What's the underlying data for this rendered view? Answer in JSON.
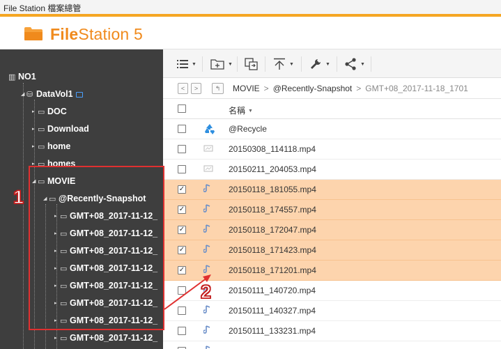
{
  "window": {
    "title": "File Station 檔案總管"
  },
  "app": {
    "logo_bold": "File",
    "logo_rest": "Station 5",
    "accent": "#f08a1c"
  },
  "tree": {
    "root": "NO1",
    "volume": "DataVol1",
    "folders": [
      "DOC",
      "Download",
      "home",
      "homes"
    ],
    "movie": "MOVIE",
    "snapshot": "@Recently-Snapshot",
    "snapshots": [
      "GMT+08_2017-11-12_",
      "GMT+08_2017-11-12_",
      "GMT+08_2017-11-12_",
      "GMT+08_2017-11-12_",
      "GMT+08_2017-11-12_",
      "GMT+08_2017-11-12_",
      "GMT+08_2017-11-12_",
      "GMT+08_2017-11-12_"
    ]
  },
  "toolbar": {
    "view": "list-view-icon",
    "new_folder": "new-folder-icon",
    "copy": "copy-icon",
    "upload": "upload-icon",
    "tools": "wrench-icon",
    "share": "share-icon"
  },
  "path": {
    "crumbs": [
      "MOVIE",
      "@Recently-Snapshot"
    ],
    "current": "GMT+08_2017-11-18_1701"
  },
  "list": {
    "header_name": "名稱",
    "files": [
      {
        "name": "@Recycle",
        "type": "recycle",
        "checked": false
      },
      {
        "name": "20150308_114118.mp4",
        "type": "file",
        "checked": false
      },
      {
        "name": "20150211_204053.mp4",
        "type": "file",
        "checked": false
      },
      {
        "name": "20150118_181055.mp4",
        "type": "video",
        "checked": true
      },
      {
        "name": "20150118_174557.mp4",
        "type": "video",
        "checked": true
      },
      {
        "name": "20150118_172047.mp4",
        "type": "video",
        "checked": true
      },
      {
        "name": "20150118_171423.mp4",
        "type": "video",
        "checked": true
      },
      {
        "name": "20150118_171201.mp4",
        "type": "video",
        "checked": true
      },
      {
        "name": "20150111_140720.mp4",
        "type": "video",
        "checked": false
      },
      {
        "name": "20150111_140327.mp4",
        "type": "video",
        "checked": false
      },
      {
        "name": "20150111_133231.mp4",
        "type": "video",
        "checked": false
      },
      {
        "name": "",
        "type": "video",
        "checked": false
      }
    ]
  },
  "annotations": {
    "one": "1",
    "two": "2"
  }
}
